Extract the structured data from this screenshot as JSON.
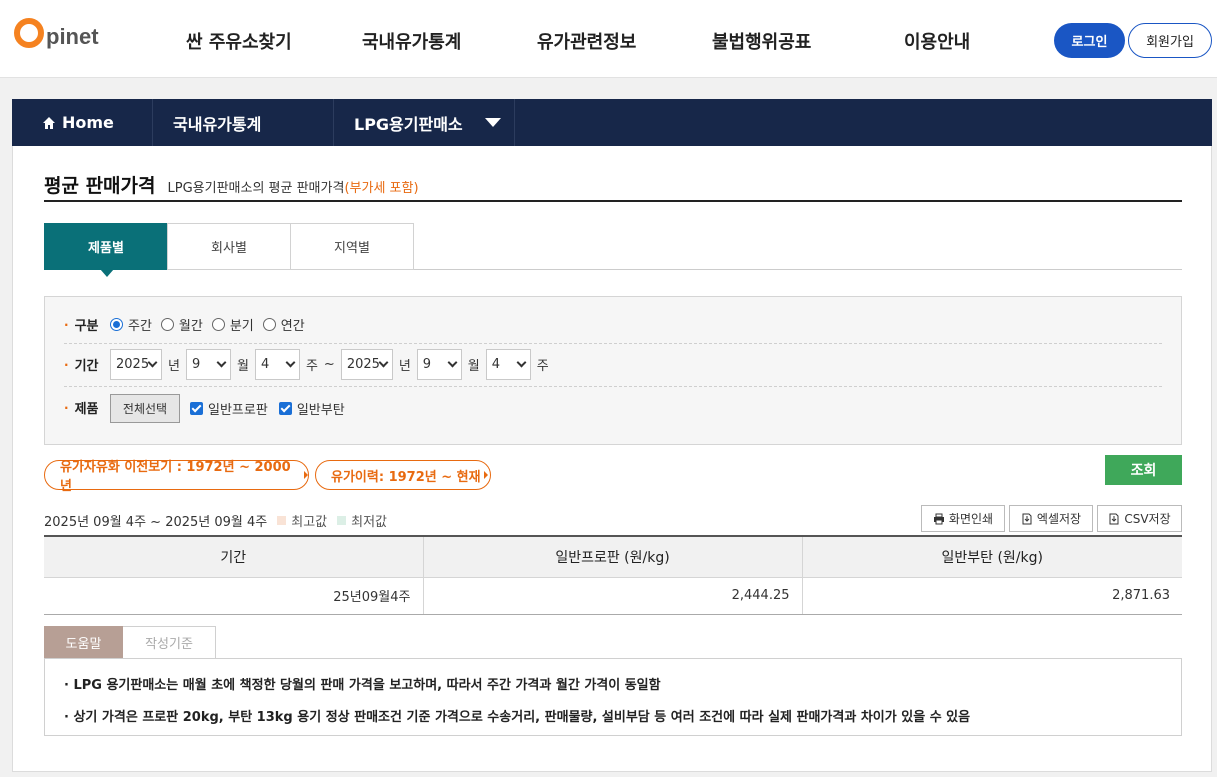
{
  "header": {
    "logo_o": "O",
    "logo_text": "pinet",
    "nav": [
      "싼 주유소찾기",
      "국내유가통계",
      "유가관련정보",
      "불법행위공표",
      "이용안내"
    ],
    "login": "로그인",
    "join": "회원가입"
  },
  "breadcrumb": {
    "home": "Home",
    "level1": "국내유가통계",
    "level2": "LPG용기판매소"
  },
  "page": {
    "title": "평균 판매가격",
    "subtitle": "LPG용기판매소의 평균 판매가격",
    "subtitle_note": "(부가세 포함)"
  },
  "tabs": [
    "제품별",
    "회사별",
    "지역별"
  ],
  "filter": {
    "period_type_label": "구분",
    "period_types": [
      "주간",
      "월간",
      "분기",
      "연간"
    ],
    "selected_period_type": "주간",
    "range_label": "기간",
    "from": {
      "year": "2025",
      "month": "9",
      "week": "4"
    },
    "to": {
      "year": "2025",
      "month": "9",
      "week": "4"
    },
    "unit_year": "년",
    "unit_month": "월",
    "unit_week": "주",
    "tilde": "~",
    "product_label": "제품",
    "select_all": "전체선택",
    "products": [
      "일반프로판",
      "일반부탄"
    ]
  },
  "links": {
    "history_liberalization": "유가자유화 이전보기 : 1972년 ~ 2000년",
    "history_price": "유가이력: 1972년 ~ 현재"
  },
  "search_button": "조회",
  "result": {
    "period_text": "2025년 09월 4주  ~ 2025년 09월 4주",
    "legend_high": "최고값",
    "legend_low": "최저값",
    "print": "화면인쇄",
    "excel": "엑셀저장",
    "csv": "CSV저장"
  },
  "table": {
    "headers": [
      "기간",
      "일반프로판 (원/kg)",
      "일반부탄 (원/kg)"
    ],
    "rows": [
      [
        "25년09월4주",
        "2,444.25",
        "2,871.63"
      ]
    ]
  },
  "help": {
    "tabs": [
      "도움말",
      "작성기준"
    ],
    "lines": [
      "· LPG 용기판매소는 매월 초에 책정한 당월의 판매 가격을 보고하며, 따라서 주간 가격과 월간 가격이 동일함",
      "· 상기 가격은 프로판 20kg, 부탄 13kg 용기 정상 판매조건 기준 가격으로 수송거리, 판매물량, 설비부담 등 여러 조건에 따라 실제 판매가격과 차이가 있을 수 있음"
    ]
  },
  "colors": {
    "navy": "#172749",
    "teal": "#0a7078",
    "orange": "#e86a10",
    "green": "#3fa85a",
    "blue": "#1a56c4",
    "legend_high": "#f9e3d6",
    "legend_low": "#dcefe6"
  }
}
